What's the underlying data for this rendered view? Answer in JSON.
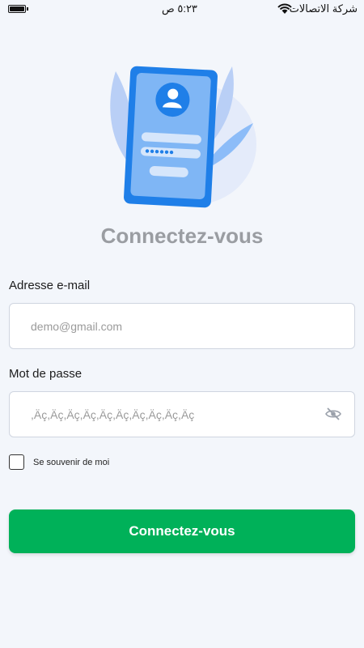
{
  "status_bar": {
    "clock": "٥:٢٣ ص",
    "carrier": "شركة الاتصالات"
  },
  "login": {
    "title": "Connectez-vous",
    "email_label": "Adresse e-mail",
    "email_placeholder": "demo@gmail.com",
    "password_label": "Mot de passe",
    "password_placeholder": ",Äç,Äç,Äç,Äç,Äç,Äç,Äç,Äç,Äç,Äç",
    "remember_label": "Se souvenir de moi",
    "remember_checked": false,
    "submit_label": "Connectez-vous"
  },
  "colors": {
    "primary": "#00b159",
    "background": "#f3f6fb",
    "title": "#9a9da2",
    "illustration_blue": "#2a8cf0"
  }
}
